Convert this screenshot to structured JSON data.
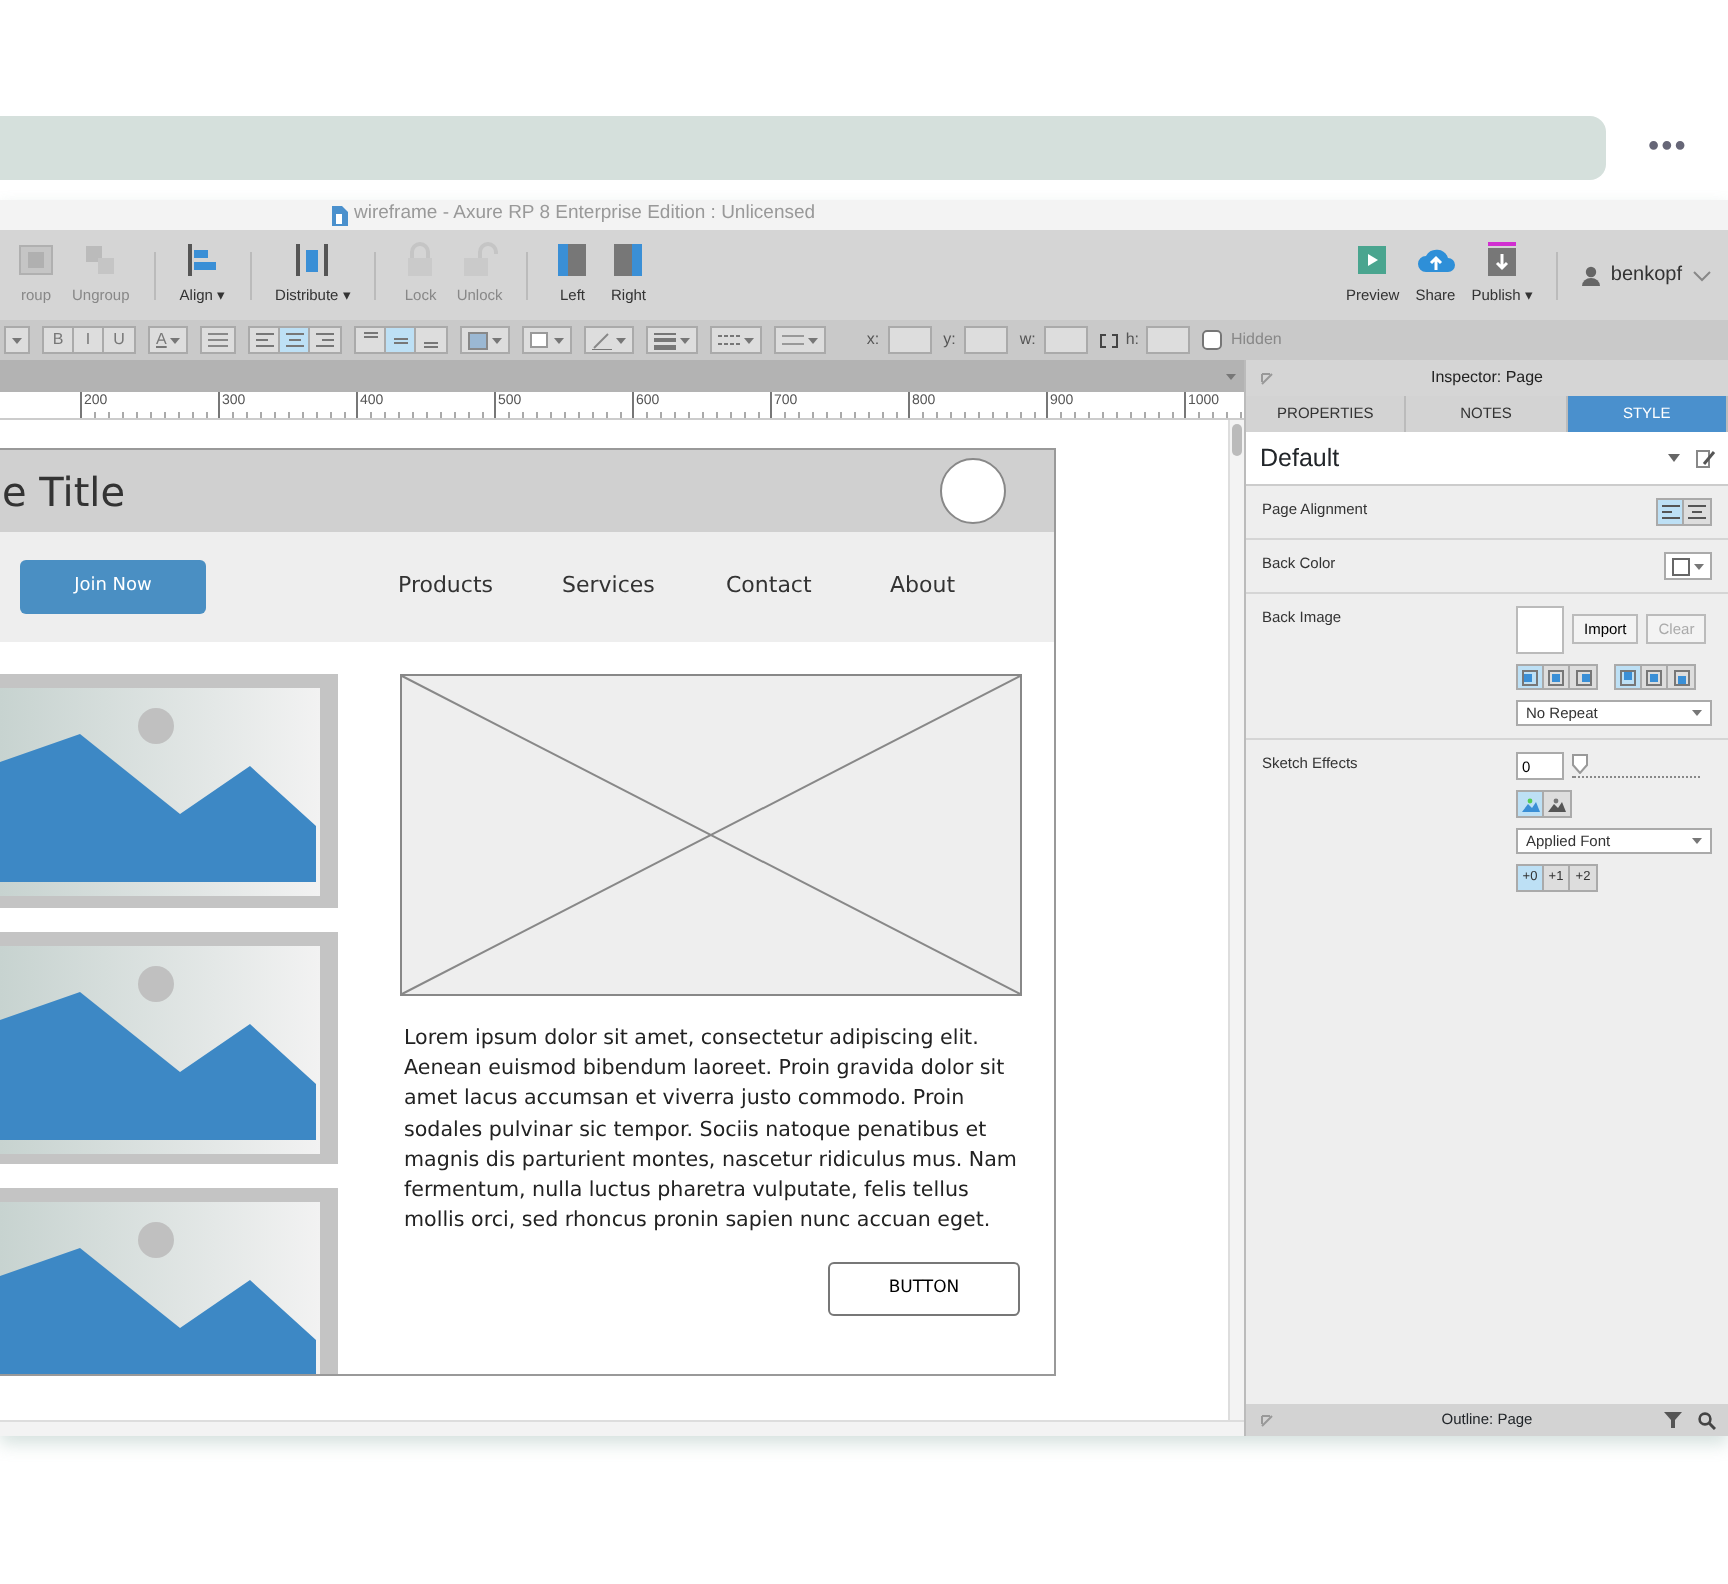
{
  "top_bar": {
    "menu": "•••"
  },
  "window": {
    "title": "wireframe - Axure RP 8 Enterprise Edition : Unlicensed"
  },
  "toolbar": {
    "tools": [
      {
        "label": "roup",
        "kind": "group",
        "disabled": true
      },
      {
        "label": "Ungroup",
        "kind": "ungroup",
        "disabled": true
      },
      {
        "label": "Align ▾",
        "kind": "align",
        "disabled": false
      },
      {
        "label": "Distribute ▾",
        "kind": "distribute",
        "disabled": false
      },
      {
        "label": "Lock",
        "kind": "lock",
        "disabled": true
      },
      {
        "label": "Unlock",
        "kind": "unlock",
        "disabled": true
      },
      {
        "label": "Left",
        "kind": "left",
        "disabled": false
      },
      {
        "label": "Right",
        "kind": "right",
        "disabled": false
      }
    ],
    "actions": [
      {
        "label": "Preview",
        "kind": "preview"
      },
      {
        "label": "Share",
        "kind": "share"
      },
      {
        "label": "Publish ▾",
        "kind": "publish"
      }
    ],
    "user": "benkopf"
  },
  "format_bar": {
    "items": [
      {
        "kind": "dropdown"
      },
      {
        "kind": "group",
        "buttons": [
          {
            "label": "B",
            "selected": false
          },
          {
            "label": "I",
            "selected": false
          },
          {
            "label": "U",
            "selected": false
          }
        ]
      },
      {
        "kind": "dropdown",
        "label": "A"
      },
      {
        "kind": "icon"
      },
      {
        "kind": "group",
        "buttons": [
          {
            "selected": false
          },
          {
            "selected": true
          },
          {
            "selected": false
          }
        ]
      },
      {
        "kind": "group",
        "buttons": [
          {
            "selected": false
          },
          {
            "selected": true
          },
          {
            "selected": false
          }
        ]
      },
      {
        "kind": "dropdown"
      },
      {
        "kind": "dropdown"
      },
      {
        "kind": "dropdown"
      },
      {
        "kind": "dropdown"
      },
      {
        "kind": "dropdown"
      },
      {
        "kind": "dropdown"
      }
    ],
    "fields": [
      {
        "label": "x:"
      },
      {
        "label": "y:"
      },
      {
        "label": "w:"
      },
      {
        "label": "h:",
        "lock": true
      }
    ],
    "hidden": {
      "label": "Hidden",
      "checked": false
    }
  },
  "ruler": {
    "ticks": [
      "200",
      "300",
      "400",
      "500",
      "600",
      "700",
      "800",
      "900",
      "1000"
    ]
  },
  "wireframe": {
    "title": "e Title",
    "cta": "Join Now",
    "nav": [
      "Products",
      "Services",
      "Contact",
      "About"
    ],
    "paragraph": "Lorem ipsum dolor sit amet, consectetur adipiscing elit. Aenean euismod bibendum laoreet. Proin gravida dolor sit amet lacus accumsan et viverra justo commodo. Proin sodales pulvinar sic tempor. Sociis natoque penatibus et magnis dis parturient montes, nascetur ridiculus mus. Nam fermentum, nulla luctus pharetra vulputate, felis tellus mollis orci, sed rhoncus pronin sapien nunc accuan eget.",
    "button": "BUTTON"
  },
  "inspector": {
    "title": "Inspector: Page",
    "tabs": [
      {
        "label": "PROPERTIES",
        "selected": false
      },
      {
        "label": "NOTES",
        "selected": false
      },
      {
        "label": "STYLE",
        "selected": true
      }
    ],
    "style": "Default",
    "page_alignment": {
      "label": "Page Alignment",
      "options": [
        {
          "selected": true
        },
        {
          "selected": false
        }
      ]
    },
    "back_color": {
      "label": "Back Color"
    },
    "back_image": {
      "label": "Back Image",
      "import": "Import",
      "clear": {
        "label": "Clear",
        "disabled": true
      },
      "horizontal": [
        {
          "selected": true
        },
        {
          "selected": false
        },
        {
          "selected": false
        }
      ],
      "vertical": [
        {
          "selected": true
        },
        {
          "selected": false
        },
        {
          "selected": false
        }
      ],
      "repeat": "No Repeat"
    },
    "sketch": {
      "label": "Sketch Effects",
      "value": "0",
      "level": 0,
      "modes": [
        {
          "selected": true
        },
        {
          "selected": false
        }
      ],
      "font": "Applied Font",
      "widths": [
        {
          "label": "+0",
          "selected": true
        },
        {
          "label": "+1",
          "selected": false
        },
        {
          "label": "+2",
          "selected": false
        }
      ]
    }
  },
  "outline": {
    "title": "Outline: Page"
  }
}
